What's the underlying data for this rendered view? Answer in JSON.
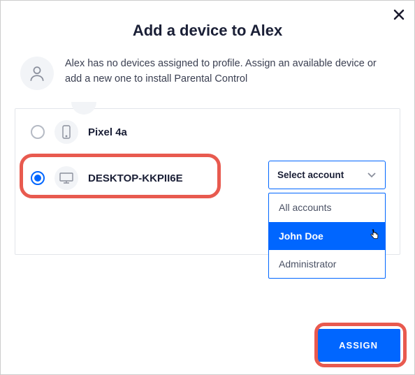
{
  "modal": {
    "title": "Add a device to Alex",
    "subtitle": "Alex has no devices assigned to profile. Assign an available device or add a new one to install Parental Control"
  },
  "devices": [
    {
      "name": "Pixel 4a",
      "icon": "phone-icon",
      "selected": false
    },
    {
      "name": "DESKTOP-KKPII6E",
      "icon": "monitor-icon",
      "selected": true
    }
  ],
  "account_select": {
    "placeholder": "Select account",
    "options": [
      {
        "label": "All accounts",
        "hovered": false
      },
      {
        "label": "John Doe",
        "hovered": true
      },
      {
        "label": "Administrator",
        "hovered": false
      }
    ]
  },
  "actions": {
    "assign_label": "ASSIGN"
  },
  "colors": {
    "primary": "#0066ff",
    "highlight": "#e85a4f",
    "text_dark": "#1a1f36"
  }
}
